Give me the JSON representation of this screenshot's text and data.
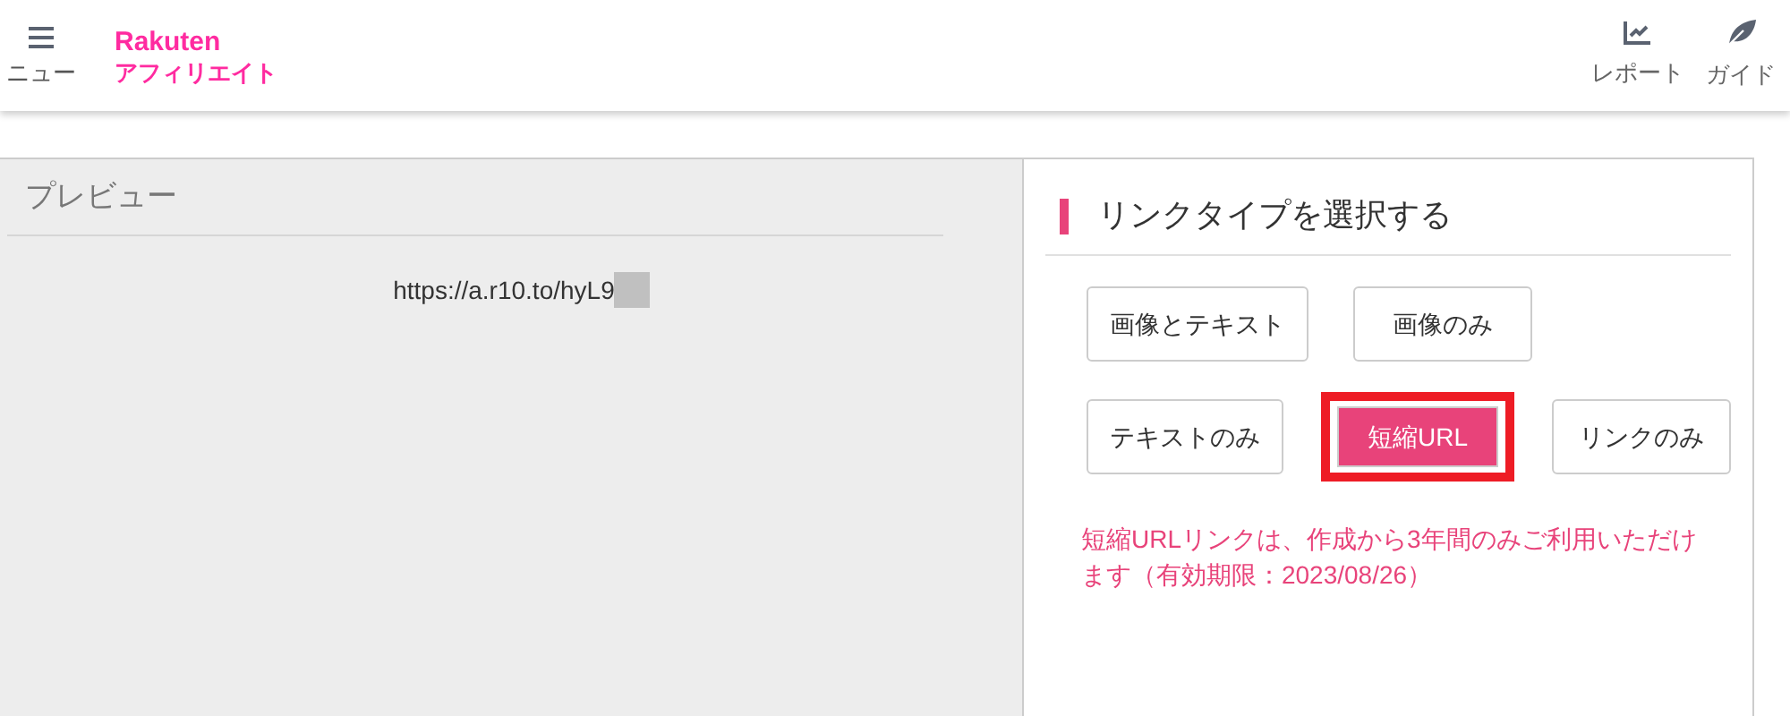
{
  "header": {
    "menu_label": "ニュー",
    "logo": {
      "top": "Rakuten",
      "bottom": "アフィリエイト"
    },
    "nav": [
      {
        "kind": "report",
        "label": "レポート"
      },
      {
        "kind": "guide",
        "label": "ガイド"
      }
    ]
  },
  "preview": {
    "title": "プレビュー",
    "url": "https://a.r10.to/hyL9"
  },
  "link_type": {
    "title": "リンクタイプを選択する",
    "rows": [
      [
        {
          "label": "画像とテキスト",
          "selected": false
        },
        {
          "label": "画像のみ",
          "selected": false
        }
      ],
      [
        {
          "label": "テキストのみ",
          "selected": false
        },
        {
          "label": "短縮URL",
          "selected": true
        },
        {
          "label": "リンクのみ",
          "selected": false
        }
      ]
    ],
    "notice": "短縮URLリンクは、作成から3年間のみご利用いただけます（有効期限：2023/08/26）"
  }
}
